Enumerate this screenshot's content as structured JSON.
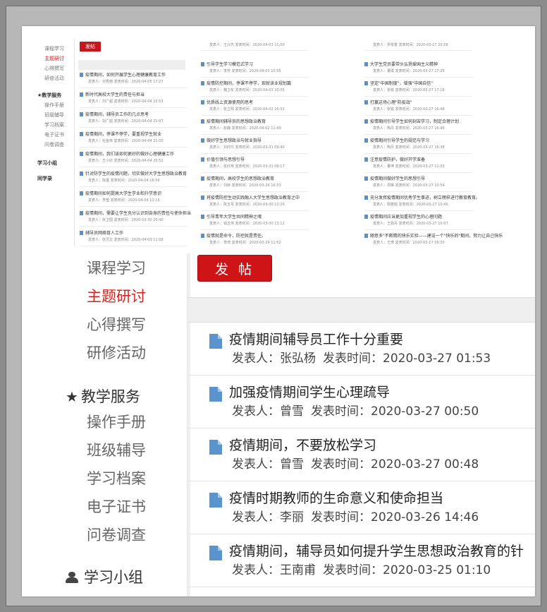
{
  "preview": {
    "sidebar": [
      {
        "label": "课程学习",
        "active": false
      },
      {
        "label": "主题研讨",
        "active": true
      },
      {
        "label": "心得撰写",
        "active": false
      },
      {
        "label": "研修活动",
        "active": false
      },
      {
        "label": "★教学服务",
        "head": true
      },
      {
        "label": "操作手册"
      },
      {
        "label": "班级辅导"
      },
      {
        "label": "学习档案"
      },
      {
        "label": "电子证书"
      },
      {
        "label": "问卷调查"
      },
      {
        "label": "学习小组",
        "head": true
      },
      {
        "label": "同学录",
        "head": true
      }
    ],
    "post_button": "发帖",
    "columns": [
      [
        {
          "title": "疫情期间，如何开展学生心理健康教育工作",
          "meta": "发表人：许秀丽 发表时间：2020-04-05 17:27"
        },
        {
          "title": "新时代高校大学生的责任与担当",
          "meta": "发表人：刘广超 发表时间：2020-04-04 22:53"
        },
        {
          "title": "疫情期间，辅导员工作的几点思考",
          "meta": "发表人：刘广超 发表时间：2020-04-04 21:07"
        },
        {
          "title": "疫情期间，停课不停学，要重视学生就业",
          "meta": "发表人：杜金林 发表时间：2020-04-04 21:00"
        },
        {
          "title": "疫情期间，我们该如何更好的做好心理健康工作",
          "meta": "发表人：王小红 发表时间：2020-04-04 20:52"
        },
        {
          "title": "针对防学生的疫情问题，切实做好大学生思想政治教育",
          "meta": "发表人：陈勇 发表时间：2020-04-04 16:56"
        },
        {
          "title": "疫情期间如何提高大学生学业和升学意识",
          "meta": "发表人：李莹 发表时间：2020-04-04 11:15"
        },
        {
          "title": "疫情期间，需要让学生充分认识到自身的责任与使命担当",
          "meta": "发表人：张卫国 发表时间：2020-03-30 20:40"
        },
        {
          "title": "辅导员网络育人工作",
          "meta": "发表人：张灵文 发表时间：2020-04-03 11:08"
        }
      ],
      [
        {
          "title": "",
          "meta": "发表人：王兴杰 发表时间：2020-04-03 11:00"
        },
        {
          "title": "引导学生学习模范式学习",
          "meta": "发表人：李芳 发表时间：2020-04-03 10:55"
        },
        {
          "title": "疫情防控期间，停课不停学，现就读业规划篇",
          "meta": "发表人：魏卫东 发表时间：2020-04-03 10:05"
        },
        {
          "title": "优质线上资源使用的思考",
          "meta": "发表人：张立阳 发表时间：2020-04-02 16:33"
        },
        {
          "title": "疫情期间辅导员的思想政治教育",
          "meta": "发表人：赵静 发表时间：2020-04-02 11:49"
        },
        {
          "title": "做好学生思想政治与就业指导",
          "meta": "发表人：刘红玲 发表时间：2020-03-31 09:40"
        },
        {
          "title": "价值引领与思想引导",
          "meta": "发表人：张红林 发表时间：2020-03-31 09:17"
        },
        {
          "title": "疫情期间，高校学生的思想政治教育",
          "meta": "发表人：刘娇 发表时间：2020-03-26 16:53"
        },
        {
          "title": "将疫情防控生动实践融入大学生思想政治教育之中",
          "meta": "发表人：陈玉琴 发表时间：2020-03-30 13:20"
        },
        {
          "title": "引导青年大学生共同精神之魂",
          "meta": "发表人：钱玉伟 发表时间：2020-03-30 13:12"
        },
        {
          "title": "疫情就是命令，防控就是责任。",
          "meta": "发表人：李琦 发表时间：2020-03-29 11:52"
        }
      ],
      [
        {
          "title": "",
          "meta": "发表人：罗俊香 发表时间：2020-03-27 20:58"
        },
        {
          "title": "大学生党员要带头弘扬爱国主义精神",
          "meta": "发表人：董璞 发表时间：2020-03-27 17:25"
        },
        {
          "title": "坚定\"中国制度\"，增强\"中国自信\"",
          "meta": "发表人：张锐 发表时间：2020-03-27 17:16"
        },
        {
          "title": "打赢这场心理\"防疫战\"",
          "meta": "发表人：张锐 发表时间：2020-03-27 16:48"
        },
        {
          "title": "疫情期间引导学生如何刻苦学习，制定合理计划",
          "meta": "发表人：陶丹 发表时间：2020-03-27 16:46"
        },
        {
          "title": "疫情期间引导学生的规范与学习",
          "meta": "发表人：陶丹 发表时间：2020-03-27 16:38"
        },
        {
          "title": "注意疫情防护，做好开学准备",
          "meta": "发表人：董坤 发表时间：2020-03-27 11:03"
        },
        {
          "title": "疫情期间做好学生的思想引导",
          "meta": "发表人：周琳 发表时间：2020-03-27 10:54"
        },
        {
          "title": "充分发挥疫情期间优秀学生事迹，树立榜样进行教育教育。",
          "meta": "发表人：陈丽琼 发表时间：2020-03-27 10:40"
        },
        {
          "title": "疫情期间应当更加重视学生的心理问题",
          "meta": "发表人：王如丹 发表时间：2020-03-27 10:07"
        },
        {
          "title": "随意多\"不断精的快乐实验——建设一个\"快乐的\"期间，努力让自己快乐",
          "meta": "发表人：王琦 发表时间：2020-03-27 09:30"
        }
      ]
    ]
  },
  "sidebar": {
    "items": [
      {
        "label": "课程学习",
        "active": false
      },
      {
        "label": "主题研讨",
        "active": true
      },
      {
        "label": "心得撰写",
        "active": false
      },
      {
        "label": "研修活动",
        "active": false
      }
    ],
    "section_teaching": {
      "label": "教学服务",
      "icon": "star-icon",
      "items": [
        "操作手册",
        "班级辅导",
        "学习档案",
        "电子证书",
        "问卷调查"
      ]
    },
    "section_group": {
      "label": "学习小组",
      "icon": "group-icon"
    }
  },
  "toolbar": {
    "post_label": "发 帖"
  },
  "posts": [
    {
      "title": "疫情期间辅导员工作十分重要",
      "author_label": "发表人：",
      "author": "张弘杨",
      "time_label": "发表时间：",
      "time": "2020-03-27 01:53"
    },
    {
      "title": "加强疫情期间学生心理疏导",
      "author_label": "发表人：",
      "author": "曾雪",
      "time_label": "发表时间：",
      "time": "2020-03-27 00:50"
    },
    {
      "title": "疫情期间，不要放松学习",
      "author_label": "发表人：",
      "author": "曾雪",
      "time_label": "发表时间：",
      "time": "2020-03-27 00:48"
    },
    {
      "title": "疫情时期教师的生命意义和使命担当",
      "author_label": "发表人：",
      "author": "李丽",
      "time_label": "发表时间：",
      "time": "2020-03-26 14:46"
    },
    {
      "title": "疫情期间，辅导员如何提升学生思想政治教育的针",
      "author_label": "发表人：",
      "author": "王南甫",
      "time_label": "发表时间：",
      "time": "2020-03-25 01:10"
    }
  ],
  "colors": {
    "accent": "#d6201c",
    "button": "#cf1417",
    "icon": "#5b93cc"
  }
}
